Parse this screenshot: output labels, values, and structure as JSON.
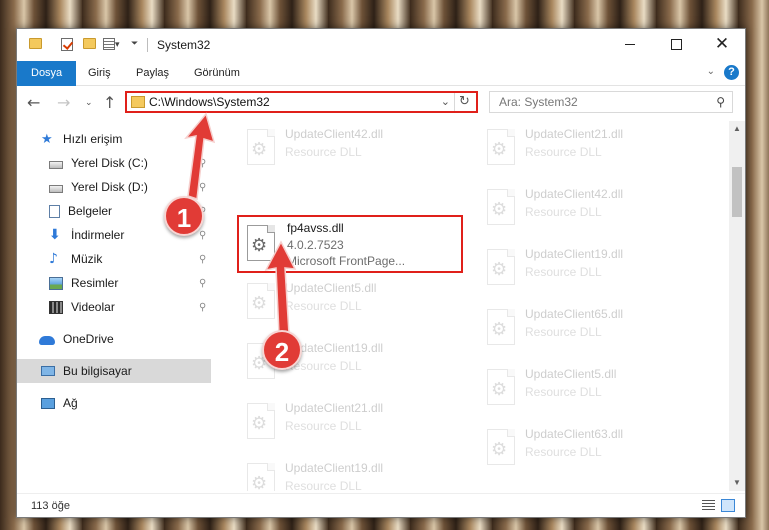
{
  "window": {
    "title": "System32",
    "minimize_icon": "minimize-icon",
    "maximize_icon": "maximize-icon",
    "close_glyph": "✕"
  },
  "ribbon": {
    "tabs": [
      {
        "label": "Dosya",
        "active": true
      },
      {
        "label": "Giriş",
        "active": false
      },
      {
        "label": "Paylaş",
        "active": false
      },
      {
        "label": "Görünüm",
        "active": false
      }
    ],
    "help": "?"
  },
  "nav": {
    "back": "←",
    "forward": "→",
    "recent": "⌄",
    "up": "↑",
    "address": "C:\\Windows\\System32",
    "refresh": "↻",
    "dropdown": "⌄",
    "search_placeholder": "Ara: System32",
    "search_glyph": "⚲"
  },
  "sidebar": {
    "items": [
      {
        "label": "Hızlı erişim",
        "icon": "star-icon",
        "pinned": false
      },
      {
        "label": "Yerel Disk (C:)",
        "icon": "disk-icon",
        "pinned": true
      },
      {
        "label": "Yerel Disk (D:)",
        "icon": "disk-icon",
        "pinned": true
      },
      {
        "label": "Belgeler",
        "icon": "documents-icon",
        "pinned": true
      },
      {
        "label": "İndirmeler",
        "icon": "download-icon",
        "pinned": true
      },
      {
        "label": "Müzik",
        "icon": "music-icon",
        "pinned": true
      },
      {
        "label": "Resimler",
        "icon": "pictures-icon",
        "pinned": true
      },
      {
        "label": "Videolar",
        "icon": "videos-icon",
        "pinned": true
      },
      {
        "label": "OneDrive",
        "icon": "cloud-icon",
        "pinned": false
      },
      {
        "label": "Bu bilgisayar",
        "icon": "computer-icon",
        "pinned": false,
        "selected": true
      },
      {
        "label": "Ağ",
        "icon": "network-icon",
        "pinned": false
      }
    ],
    "pin_glyph": "📌"
  },
  "files": {
    "highlighted": {
      "name": "fp4avss.dll",
      "version": "4.0.2.7523",
      "description": "Microsoft FrontPage..."
    },
    "left_column": [
      {
        "name": "UpdateClient42.dll",
        "type": "Resource DLL"
      },
      {
        "name": "UpdateClient5.dll",
        "type": "Resource DLL"
      },
      {
        "name": "UpdateClient19.dll",
        "type": "Resource DLL"
      },
      {
        "name": "UpdateClient21.dll",
        "type": "Resource DLL"
      },
      {
        "name": "UpdateClient19.dll",
        "type": "Resource DLL"
      }
    ],
    "right_column": [
      {
        "name": "UpdateClient21.dll",
        "type": "Resource DLL"
      },
      {
        "name": "UpdateClient42.dll",
        "type": "Resource DLL"
      },
      {
        "name": "UpdateClient19.dll",
        "type": "Resource DLL"
      },
      {
        "name": "UpdateClient65.dll",
        "type": "Resource DLL"
      },
      {
        "name": "UpdateClient5.dll",
        "type": "Resource DLL"
      },
      {
        "name": "UpdateClient63.dll",
        "type": "Resource DLL"
      }
    ]
  },
  "status": {
    "count": "113 öğe"
  },
  "annotations": {
    "step1": "1",
    "step2": "2",
    "accent": "#e13b36"
  },
  "colors": {
    "ribbon_active": "#1979ca",
    "highlight_border": "#e0201a",
    "selected_bg": "#d9d9d9"
  }
}
